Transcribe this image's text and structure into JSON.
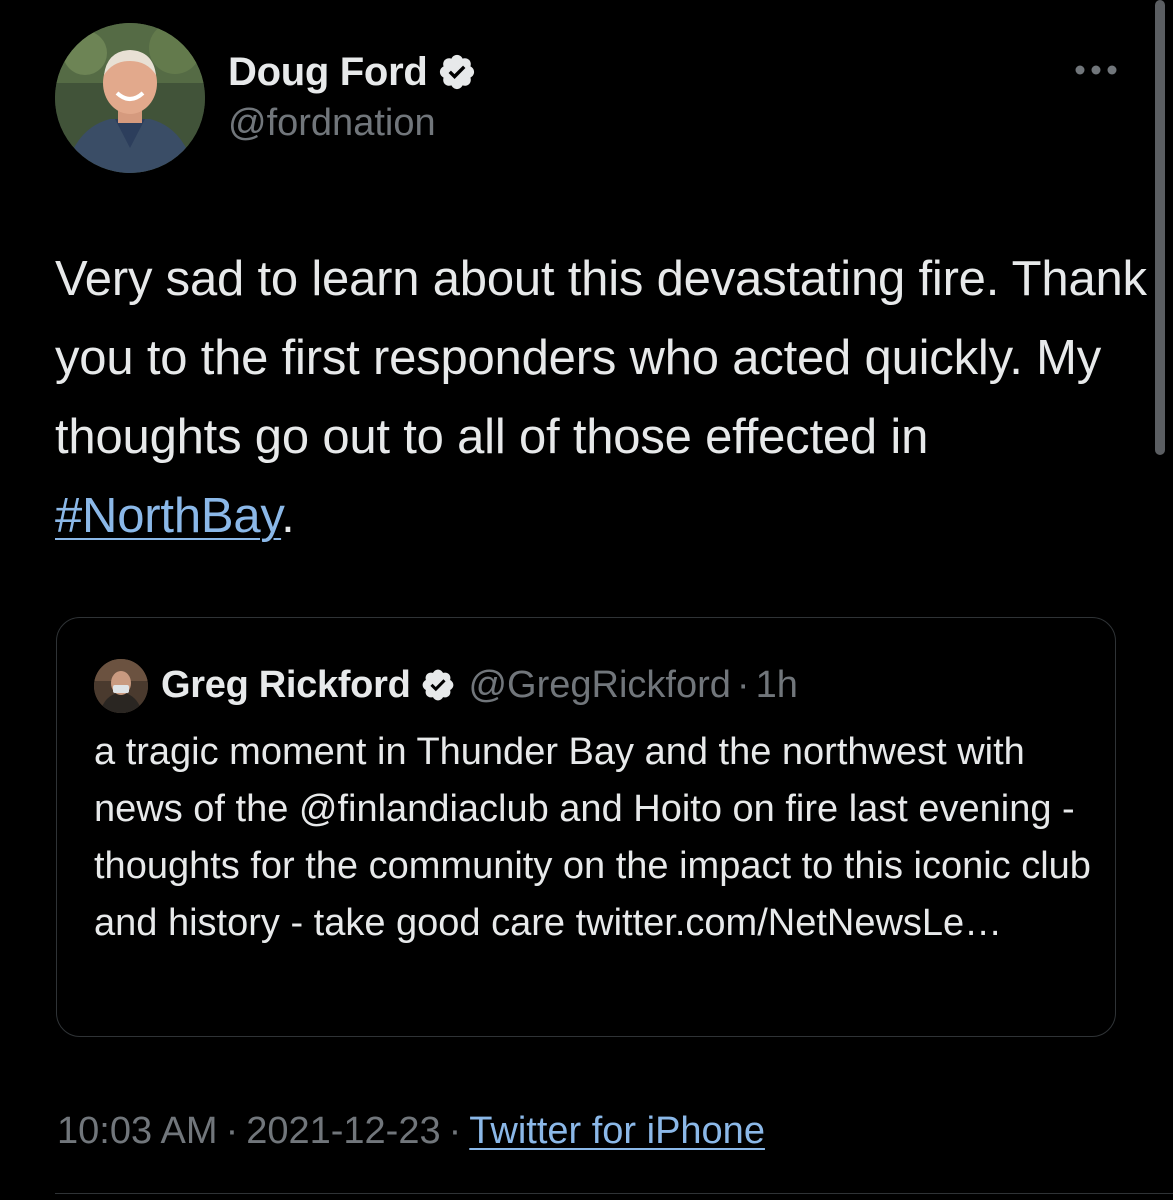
{
  "author": {
    "display_name": "Doug Ford",
    "handle": "@fordnation",
    "verified": true
  },
  "tweet": {
    "text_before": "Very sad to learn about this devastating fire. Thank you to the first responders who acted quickly. My thoughts go out to all of those effected in ",
    "hashtag": "#NorthBay",
    "text_after": "."
  },
  "quoted_tweet": {
    "display_name": "Greg Rickford",
    "handle": "@GregRickford",
    "separator": "·",
    "time_ago": "1h",
    "verified": true,
    "text": "a tragic moment in Thunder Bay and the northwest with news of the @finlandiaclub  and Hoito on fire last evening - thoughts for the community on the impact to this iconic club and history - take good care twitter.com/NetNewsLe…"
  },
  "meta": {
    "time": "10:03 AM",
    "separator": "·",
    "date": "2021-12-23",
    "source": "Twitter for iPhone"
  },
  "colors": {
    "background": "#000000",
    "text": "#e7e9ea",
    "muted": "#71767b",
    "link": "#8bb8e8",
    "border": "#2f3336"
  },
  "icons": {
    "verified": "verified-badge-icon",
    "more": "more-options-icon"
  }
}
